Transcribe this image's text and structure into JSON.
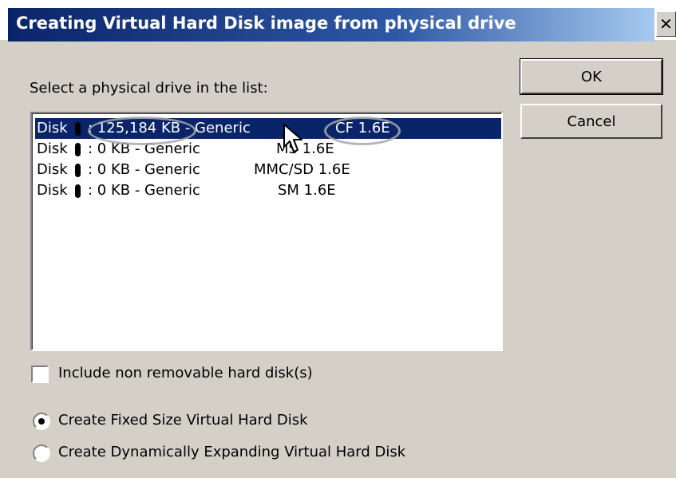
{
  "window": {
    "title": "Creating Virtual Hard Disk image from physical drive",
    "close_glyph": "✕"
  },
  "prompt": "Select a physical drive in the list:",
  "buttons": {
    "ok": "OK",
    "cancel": "Cancel"
  },
  "drives": [
    {
      "disk": "Disk",
      "size": ": 125,184 KB - Generic",
      "label": "CF 1.6E",
      "selected": true
    },
    {
      "disk": "Disk",
      "size": ": 0 KB - Generic",
      "label": "MS 1.6E",
      "selected": false
    },
    {
      "disk": "Disk",
      "size": ": 0 KB - Generic",
      "label": "MMC/SD 1.6E",
      "selected": false
    },
    {
      "disk": "Disk",
      "size": ": 0 KB - Generic",
      "label": "SM 1.6E",
      "selected": false
    }
  ],
  "include_non_removable": {
    "label": "Include non removable hard disk(s)",
    "checked": false
  },
  "disk_type": {
    "fixed": {
      "label": "Create Fixed Size Virtual Hard Disk",
      "selected": true
    },
    "dynamic": {
      "label": "Create Dynamically Expanding Virtual Hard Disk",
      "selected": false
    }
  },
  "colors": {
    "title_bar": "#0a246a",
    "selection": "#0a246a",
    "dialog_bg": "#d4d0c8"
  },
  "icons": {
    "close": "close-icon",
    "cursor": "mouse-cursor-icon"
  }
}
